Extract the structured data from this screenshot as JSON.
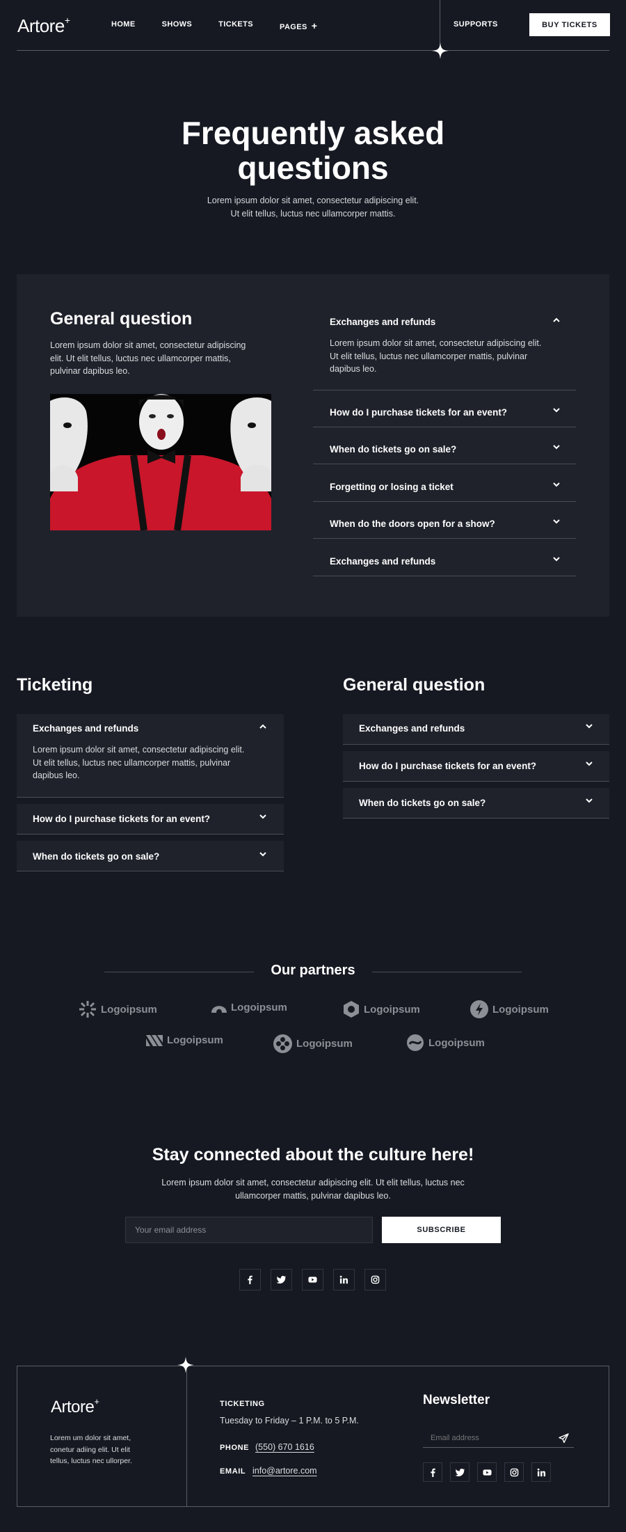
{
  "header": {
    "logo": "Artore",
    "logo_mark": "+",
    "nav": [
      "HOME",
      "SHOWS",
      "TICKETS",
      "PAGES"
    ],
    "supports": "SUPPORTS",
    "buy": "BUY TICKETS"
  },
  "hero": {
    "title_line1": "Frequently asked",
    "title_line2": "questions",
    "sub_line1": "Lorem ipsum dolor sit amet, consectetur adipiscing elit.",
    "sub_line2": "Ut elit tellus, luctus nec ullamcorper mattis."
  },
  "panel": {
    "title": "General question",
    "text_line1": "Lorem ipsum dolor sit amet, consectetur adipiscing",
    "text_line2": "elit. Ut elit tellus, luctus nec ullamcorper mattis,",
    "text_line3": "pulvinar dapibus leo.",
    "faq": [
      {
        "q": "Exchanges and refunds",
        "open": true,
        "a1": "Lorem ipsum dolor sit amet, consectetur adipiscing elit.",
        "a2": "Ut elit tellus, luctus nec ullamcorper mattis, pulvinar",
        "a3": "dapibus leo."
      },
      {
        "q": "How do I purchase tickets for an event?"
      },
      {
        "q": "When do tickets go on sale?"
      },
      {
        "q": "Forgetting or losing a ticket"
      },
      {
        "q": "When do the doors open for a show?"
      },
      {
        "q": "Exchanges and refunds"
      }
    ]
  },
  "ticketing": {
    "title": "Ticketing",
    "faq": [
      {
        "q": "Exchanges and refunds",
        "open": true,
        "a1": "Lorem ipsum dolor sit amet, consectetur adipiscing elit.",
        "a2": "Ut elit tellus, luctus nec ullamcorper mattis, pulvinar",
        "a3": "dapibus leo."
      },
      {
        "q": "How do I purchase tickets for an event?"
      },
      {
        "q": "When do tickets go on sale?"
      }
    ]
  },
  "general": {
    "title": "General question",
    "faq": [
      {
        "q": "Exchanges and refunds"
      },
      {
        "q": "How do I purchase tickets for an event?"
      },
      {
        "q": "When do tickets go on sale?"
      }
    ]
  },
  "partners": {
    "title": "Our partners",
    "logos": [
      "Logoipsum",
      "Logoipsum",
      "Logoipsum",
      "Logoipsum",
      "Logoipsum",
      "Logoipsum",
      "Logoipsum"
    ]
  },
  "newsletter": {
    "title": "Stay connected about the culture here!",
    "sub_line1": "Lorem ipsum dolor sit amet, consectetur adipiscing elit. Ut elit tellus, luctus nec",
    "sub_line2": "ullamcorper mattis, pulvinar dapibus leo.",
    "placeholder": "Your email address",
    "button": "SUBSCRIBE",
    "socials": [
      "facebook-icon",
      "twitter-icon",
      "youtube-icon",
      "linkedin-icon",
      "instagram-icon"
    ]
  },
  "footer": {
    "logo": "Artore",
    "logo_mark": "+",
    "about_line1": "Lorem um dolor sit amet,",
    "about_line2": "conetur adiing elit. Ut elit",
    "about_line3": "tellus, luctus nec ullorper.",
    "ticketing_label": "TICKETING",
    "hours": "Tuesday to Friday – 1 P.M. to 5 P.M.",
    "phone_label": "PHONE",
    "phone": "(550) 670 1616",
    "email_label": "EMAIL",
    "email": "info@artore.com",
    "newsletter_title": "Newsletter",
    "newsletter_placeholder": "Email address",
    "socials": [
      "facebook-icon",
      "twitter-icon",
      "youtube-icon",
      "instagram-icon",
      "linkedin-icon"
    ]
  },
  "colors": {
    "background": "#161922",
    "panel": "#1f222b",
    "text": "#ffffff",
    "muted": "#8d8f96"
  }
}
